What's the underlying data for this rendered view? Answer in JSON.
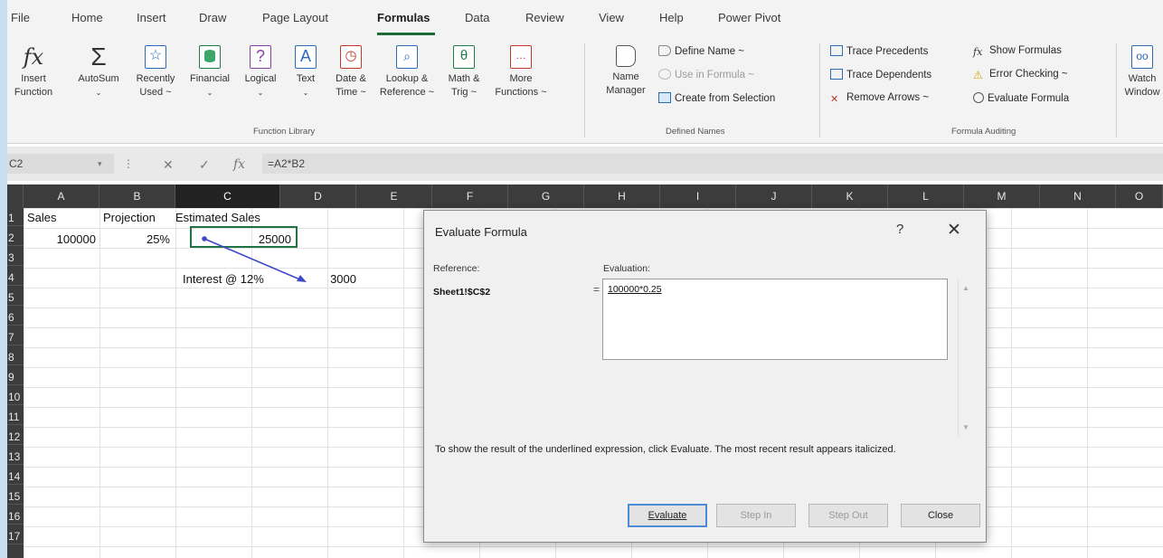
{
  "tabs": [
    "File",
    "Home",
    "Insert",
    "Draw",
    "Page Layout",
    "Formulas",
    "Data",
    "Review",
    "View",
    "Help",
    "Power Pivot"
  ],
  "active_tab": "Formulas",
  "ribbon": {
    "insert_function": [
      "Insert",
      "Function"
    ],
    "function_library": {
      "autosum": "AutoSum",
      "recently_used": [
        "Recently",
        "Used ~"
      ],
      "financial": "Financial",
      "logical": "Logical",
      "text": "Text",
      "date_time": [
        "Date &",
        "Time ~"
      ],
      "lookup_reference": [
        "Lookup &",
        "Reference ~"
      ],
      "math_trig": [
        "Math &",
        "Trig ~"
      ],
      "more_functions": [
        "More",
        "Functions ~"
      ],
      "group_label": "Function Library"
    },
    "defined_names": {
      "name_manager": [
        "Name",
        "Manager"
      ],
      "define_name": "Define Name  ~",
      "use_in_formula": "Use in Formula ~",
      "create_from_selection": "Create from Selection",
      "group_label": "Defined Names"
    },
    "formula_auditing": {
      "trace_precedents": "Trace Precedents",
      "trace_dependents": "Trace Dependents",
      "remove_arrows": "Remove Arrows  ~",
      "show_formulas": "Show Formulas",
      "error_checking": "Error Checking  ~",
      "evaluate_formula": "Evaluate Formula",
      "group_label": "Formula Auditing"
    },
    "watch_window": [
      "Watch",
      "Window"
    ]
  },
  "formula_bar": {
    "name_box": "C2",
    "fx": "fx",
    "formula": "=A2*B2"
  },
  "grid": {
    "columns": [
      "A",
      "B",
      "C",
      "D",
      "E",
      "F",
      "G",
      "H",
      "I",
      "J",
      "K",
      "L",
      "M",
      "N",
      "O"
    ],
    "selected_column": "C",
    "rows": [
      "1",
      "2",
      "3",
      "4",
      "5",
      "6",
      "7",
      "8",
      "9",
      "10",
      "11",
      "12",
      "13",
      "14",
      "15",
      "16",
      "17"
    ],
    "cells": {
      "A1": "Sales",
      "B1": "Projection",
      "C1": "Estimated Sales",
      "A2": "100000",
      "B2": "25%",
      "C2": "25000",
      "C4": "Interest @ 12%",
      "D4": "3000"
    }
  },
  "dialog": {
    "title": "Evaluate Formula",
    "help": "?",
    "close": "✕",
    "reference_label": "Reference:",
    "reference_value": "Sheet1!$C$2",
    "evaluation_label": "Evaluation:",
    "equals": "=",
    "evaluation_value": "100000*0.25",
    "note": "To show the result of the underlined expression, click Evaluate.  The most recent result appears italicized.",
    "buttons": {
      "evaluate": "Evaluate",
      "step_in": "Step In",
      "step_out": "Step Out",
      "close": "Close"
    }
  },
  "colors": {
    "accent_green": "#217346",
    "trace_arrow": "#3f49c8",
    "header_dark": "#3c3c3c"
  }
}
